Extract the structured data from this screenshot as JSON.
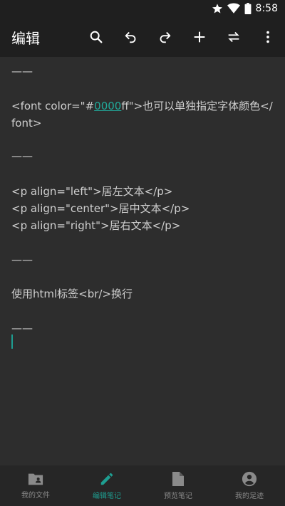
{
  "status_bar": {
    "time": "8:58"
  },
  "toolbar": {
    "title": "编辑"
  },
  "editor": {
    "rule1": "——",
    "font_line_prefix": "<font color=\"#",
    "font_line_highlight": "0000",
    "font_line_suffix": "ff\">也可以单独指定字体颜色</",
    "font_line_end": "font>",
    "rule2": "——",
    "p_left": "<p align=\"left\">居左文本</p>",
    "p_center": "<p align=\"center\">居中文本</p>",
    "p_right": "<p align=\"right\">居右文本</p>",
    "rule3": "——",
    "br_line": "使用html标签<br/>换行",
    "rule4": "——"
  },
  "bottom_nav": {
    "items": [
      {
        "label": "我的文件",
        "icon": "folder-user-icon"
      },
      {
        "label": "编辑笔记",
        "icon": "pencil-icon"
      },
      {
        "label": "预览笔记",
        "icon": "document-icon"
      },
      {
        "label": "我的足迹",
        "icon": "account-circle-icon"
      }
    ],
    "active_index": 1
  },
  "colors": {
    "accent": "#1e9e91",
    "background": "#2d2d2d",
    "toolbar": "#1f1f1f"
  }
}
